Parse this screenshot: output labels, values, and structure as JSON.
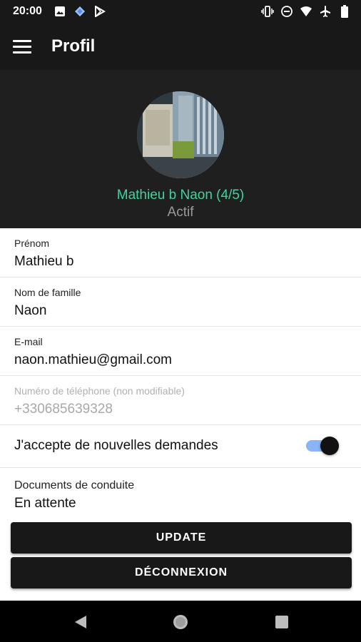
{
  "status_bar": {
    "time": "20:00",
    "left_icons": [
      "image-icon",
      "diamond-icon",
      "play-store-icon"
    ],
    "right_icons": [
      "vibrate-icon",
      "do-not-disturb-icon",
      "wifi-icon",
      "airplane-icon",
      "battery-icon"
    ]
  },
  "app_bar": {
    "title": "Profil"
  },
  "profile": {
    "name": "Mathieu b Naon (4/5)",
    "status": "Actif"
  },
  "fields": {
    "first_name": {
      "label": "Prénom",
      "value": "Mathieu b"
    },
    "last_name": {
      "label": "Nom de famille",
      "value": "Naon"
    },
    "email": {
      "label": "E-mail",
      "value": "naon.mathieu@gmail.com"
    },
    "phone": {
      "label": "Numéro de téléphone (non modifiable)",
      "value": "+330685639328"
    }
  },
  "accept_requests": {
    "label": "J'accepte de nouvelles demandes",
    "enabled": true
  },
  "driving_documents": {
    "label": "Documents de conduite",
    "value": "En attente"
  },
  "buttons": {
    "update": "UPDATE",
    "logout": "DÉCONNEXION"
  },
  "nav_bar": {
    "icons": [
      "back-icon",
      "home-icon",
      "recents-icon"
    ]
  },
  "colors": {
    "accent_green": "#3ed59b",
    "dark_bar": "#181818",
    "toggle_track": "#8ab4f8"
  }
}
